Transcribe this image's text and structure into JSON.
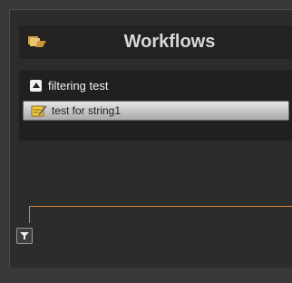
{
  "header": {
    "title": "Workflows",
    "icon": "workflows-icon"
  },
  "tree": {
    "group": {
      "label": "filtering test",
      "toggle_icon": "collapse-arrow-icon"
    },
    "items": [
      {
        "label": "test for string1",
        "icon": "edit-workflow-icon"
      }
    ]
  },
  "filter": {
    "icon": "filter-funnel-icon"
  },
  "colors": {
    "accent_line": "#d9853b"
  }
}
